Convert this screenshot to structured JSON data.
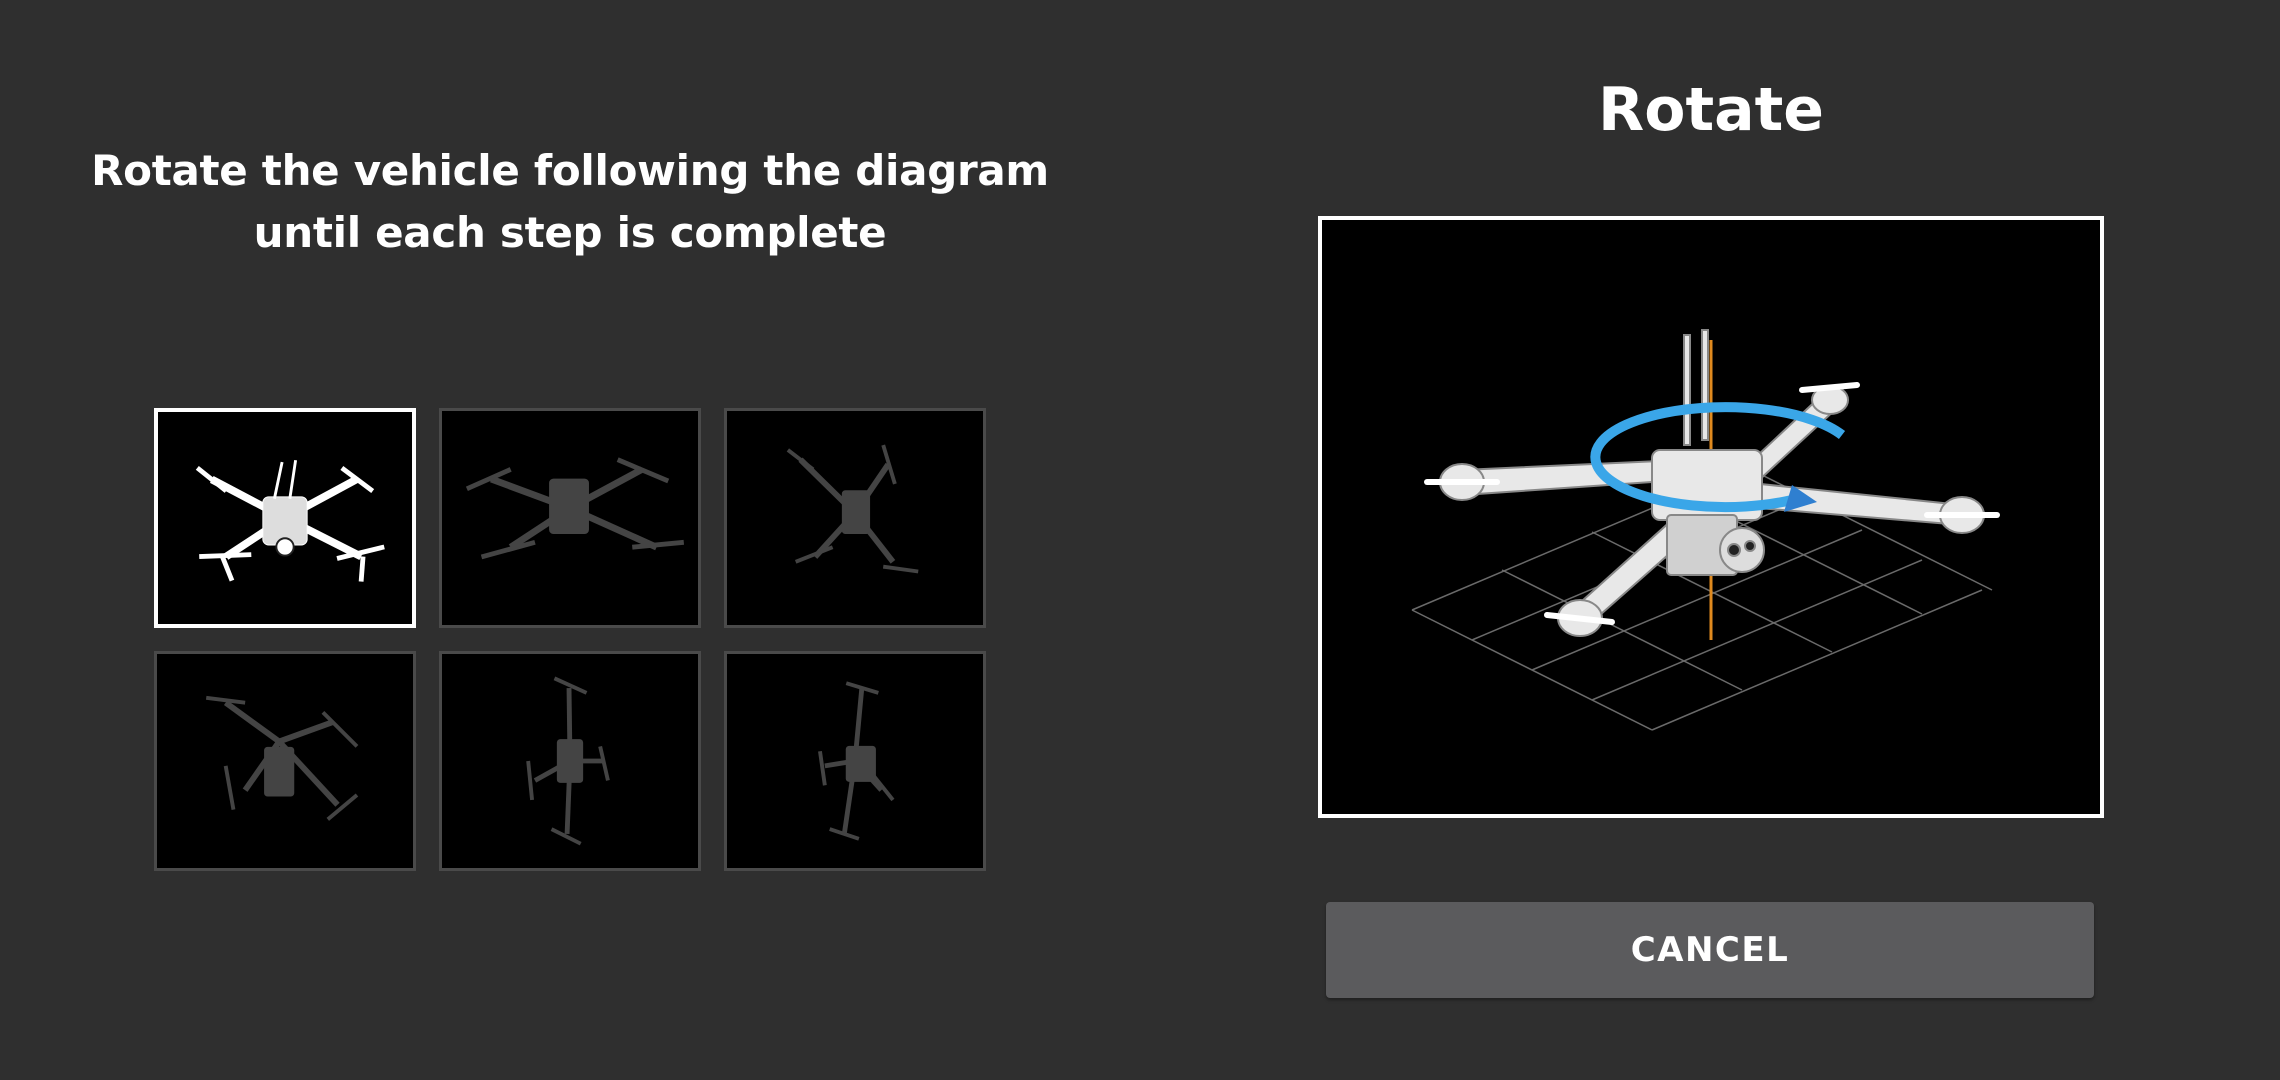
{
  "instruction": "Rotate the vehicle following the diagram until each step is complete",
  "panel": {
    "title": "Rotate"
  },
  "steps": [
    {
      "state": "active",
      "icon": "drone-orientation-icon"
    },
    {
      "state": "pending",
      "icon": "drone-orientation-icon"
    },
    {
      "state": "pending",
      "icon": "drone-orientation-icon"
    },
    {
      "state": "pending",
      "icon": "drone-orientation-icon"
    },
    {
      "state": "pending",
      "icon": "drone-orientation-icon"
    },
    {
      "state": "pending",
      "icon": "drone-orientation-icon"
    }
  ],
  "preview": {
    "icon": "drone-rotate-diagram-icon",
    "rotation_arrow_color": "#3aa6e8",
    "axis_color": "#e08a1e"
  },
  "cancel": {
    "label": "CANCEL"
  }
}
